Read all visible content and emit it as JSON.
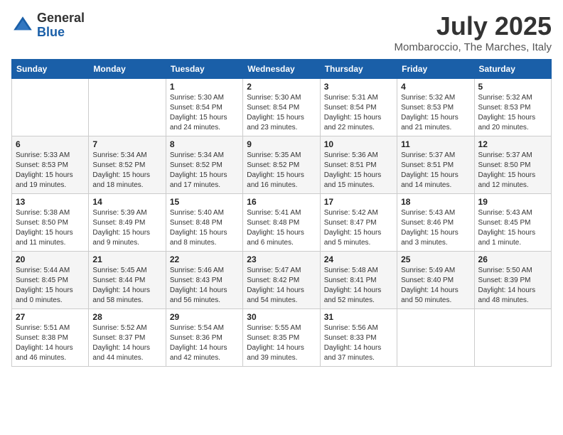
{
  "header": {
    "logo_general": "General",
    "logo_blue": "Blue",
    "month_title": "July 2025",
    "location": "Mombaroccio, The Marches, Italy"
  },
  "days_of_week": [
    "Sunday",
    "Monday",
    "Tuesday",
    "Wednesday",
    "Thursday",
    "Friday",
    "Saturday"
  ],
  "weeks": [
    [
      {
        "day": "",
        "info": ""
      },
      {
        "day": "",
        "info": ""
      },
      {
        "day": "1",
        "info": "Sunrise: 5:30 AM\nSunset: 8:54 PM\nDaylight: 15 hours and 24 minutes."
      },
      {
        "day": "2",
        "info": "Sunrise: 5:30 AM\nSunset: 8:54 PM\nDaylight: 15 hours and 23 minutes."
      },
      {
        "day": "3",
        "info": "Sunrise: 5:31 AM\nSunset: 8:54 PM\nDaylight: 15 hours and 22 minutes."
      },
      {
        "day": "4",
        "info": "Sunrise: 5:32 AM\nSunset: 8:53 PM\nDaylight: 15 hours and 21 minutes."
      },
      {
        "day": "5",
        "info": "Sunrise: 5:32 AM\nSunset: 8:53 PM\nDaylight: 15 hours and 20 minutes."
      }
    ],
    [
      {
        "day": "6",
        "info": "Sunrise: 5:33 AM\nSunset: 8:53 PM\nDaylight: 15 hours and 19 minutes."
      },
      {
        "day": "7",
        "info": "Sunrise: 5:34 AM\nSunset: 8:52 PM\nDaylight: 15 hours and 18 minutes."
      },
      {
        "day": "8",
        "info": "Sunrise: 5:34 AM\nSunset: 8:52 PM\nDaylight: 15 hours and 17 minutes."
      },
      {
        "day": "9",
        "info": "Sunrise: 5:35 AM\nSunset: 8:52 PM\nDaylight: 15 hours and 16 minutes."
      },
      {
        "day": "10",
        "info": "Sunrise: 5:36 AM\nSunset: 8:51 PM\nDaylight: 15 hours and 15 minutes."
      },
      {
        "day": "11",
        "info": "Sunrise: 5:37 AM\nSunset: 8:51 PM\nDaylight: 15 hours and 14 minutes."
      },
      {
        "day": "12",
        "info": "Sunrise: 5:37 AM\nSunset: 8:50 PM\nDaylight: 15 hours and 12 minutes."
      }
    ],
    [
      {
        "day": "13",
        "info": "Sunrise: 5:38 AM\nSunset: 8:50 PM\nDaylight: 15 hours and 11 minutes."
      },
      {
        "day": "14",
        "info": "Sunrise: 5:39 AM\nSunset: 8:49 PM\nDaylight: 15 hours and 9 minutes."
      },
      {
        "day": "15",
        "info": "Sunrise: 5:40 AM\nSunset: 8:48 PM\nDaylight: 15 hours and 8 minutes."
      },
      {
        "day": "16",
        "info": "Sunrise: 5:41 AM\nSunset: 8:48 PM\nDaylight: 15 hours and 6 minutes."
      },
      {
        "day": "17",
        "info": "Sunrise: 5:42 AM\nSunset: 8:47 PM\nDaylight: 15 hours and 5 minutes."
      },
      {
        "day": "18",
        "info": "Sunrise: 5:43 AM\nSunset: 8:46 PM\nDaylight: 15 hours and 3 minutes."
      },
      {
        "day": "19",
        "info": "Sunrise: 5:43 AM\nSunset: 8:45 PM\nDaylight: 15 hours and 1 minute."
      }
    ],
    [
      {
        "day": "20",
        "info": "Sunrise: 5:44 AM\nSunset: 8:45 PM\nDaylight: 15 hours and 0 minutes."
      },
      {
        "day": "21",
        "info": "Sunrise: 5:45 AM\nSunset: 8:44 PM\nDaylight: 14 hours and 58 minutes."
      },
      {
        "day": "22",
        "info": "Sunrise: 5:46 AM\nSunset: 8:43 PM\nDaylight: 14 hours and 56 minutes."
      },
      {
        "day": "23",
        "info": "Sunrise: 5:47 AM\nSunset: 8:42 PM\nDaylight: 14 hours and 54 minutes."
      },
      {
        "day": "24",
        "info": "Sunrise: 5:48 AM\nSunset: 8:41 PM\nDaylight: 14 hours and 52 minutes."
      },
      {
        "day": "25",
        "info": "Sunrise: 5:49 AM\nSunset: 8:40 PM\nDaylight: 14 hours and 50 minutes."
      },
      {
        "day": "26",
        "info": "Sunrise: 5:50 AM\nSunset: 8:39 PM\nDaylight: 14 hours and 48 minutes."
      }
    ],
    [
      {
        "day": "27",
        "info": "Sunrise: 5:51 AM\nSunset: 8:38 PM\nDaylight: 14 hours and 46 minutes."
      },
      {
        "day": "28",
        "info": "Sunrise: 5:52 AM\nSunset: 8:37 PM\nDaylight: 14 hours and 44 minutes."
      },
      {
        "day": "29",
        "info": "Sunrise: 5:54 AM\nSunset: 8:36 PM\nDaylight: 14 hours and 42 minutes."
      },
      {
        "day": "30",
        "info": "Sunrise: 5:55 AM\nSunset: 8:35 PM\nDaylight: 14 hours and 39 minutes."
      },
      {
        "day": "31",
        "info": "Sunrise: 5:56 AM\nSunset: 8:33 PM\nDaylight: 14 hours and 37 minutes."
      },
      {
        "day": "",
        "info": ""
      },
      {
        "day": "",
        "info": ""
      }
    ]
  ]
}
